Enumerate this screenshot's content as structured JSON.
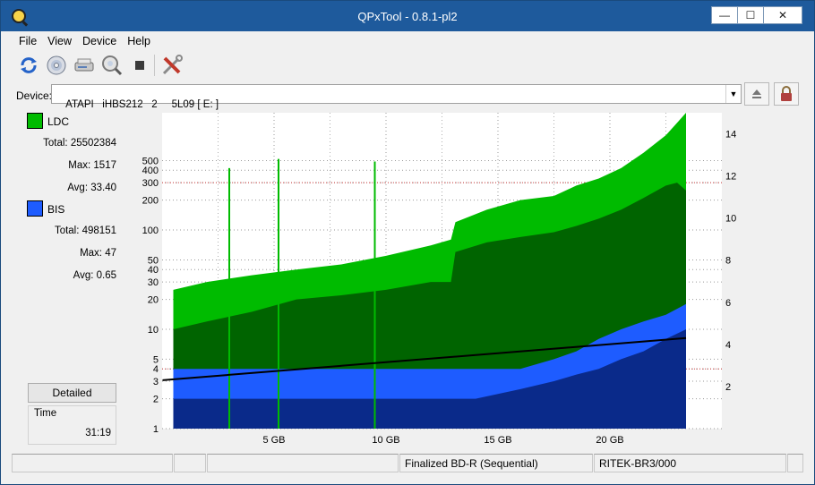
{
  "window": {
    "title": "QPxTool - 0.8.1-pl2",
    "minimize": "—",
    "maximize": "☐",
    "close": "✕"
  },
  "menu": [
    "File",
    "View",
    "Device",
    "Help"
  ],
  "toolbar": {
    "buttons": [
      "refresh-icon",
      "disc-info-icon",
      "scanner-icon",
      "disc-scan-icon",
      "stop-icon",
      "settings-tools-icon"
    ]
  },
  "device": {
    "label": "Device:",
    "value": "ATAPI   iHBS212   2     5L09 [ E: ]"
  },
  "ldc": {
    "name": "LDC",
    "color": "#00bb00",
    "total": "Total: 25502384",
    "max": "Max: 1517",
    "avg": "Avg: 33.40"
  },
  "bis": {
    "name": "BIS",
    "color": "#1e5cff",
    "total": "Total: 498151",
    "max": "Max: 47",
    "avg": "Avg: 0.65"
  },
  "detailed_label": "Detailed",
  "time": {
    "label": "Time",
    "value": "31:19"
  },
  "status": {
    "disc_type": "Finalized BD-R (Sequential)",
    "media_id": "RITEK-BR3/000"
  },
  "chart_data": {
    "type": "area",
    "y_left_scale": "log",
    "ylim_left": [
      1,
      1517
    ],
    "y_left_ticks": [
      "1",
      "2",
      "3",
      "4",
      "5",
      "10",
      "20",
      "30",
      "40",
      "50",
      "100",
      "200",
      "300",
      "400",
      "500"
    ],
    "y_right_ticks": [
      "2",
      "4",
      "6",
      "8",
      "10",
      "12",
      "14"
    ],
    "ylim_right": [
      0,
      15
    ],
    "x_ticks": [
      "5 GB",
      "10 GB",
      "15 GB",
      "20 GB"
    ],
    "xlim": [
      0,
      25
    ],
    "grid": true,
    "series": [
      {
        "name": "LDC",
        "color": "#00bb00",
        "x": [
          0.5,
          2,
          4,
          6,
          8,
          10,
          12,
          12.9,
          13.1,
          14.5,
          16,
          17.5,
          18.5,
          19.5,
          20.5,
          21.5,
          22.5,
          23,
          23.4
        ],
        "max": [
          25,
          30,
          35,
          40,
          45,
          55,
          70,
          80,
          120,
          160,
          200,
          220,
          280,
          330,
          420,
          600,
          900,
          1200,
          1517
        ],
        "avg": [
          10,
          12,
          15,
          20,
          22,
          25,
          30,
          30,
          60,
          75,
          85,
          95,
          110,
          130,
          160,
          210,
          280,
          300,
          250
        ]
      },
      {
        "name": "BIS",
        "color": "#1e5cff",
        "x": [
          0.5,
          4,
          8,
          12,
          14,
          16,
          17.5,
          18.5,
          19.5,
          20.5,
          21.5,
          22.5,
          23.4
        ],
        "max": [
          4,
          4,
          4,
          4,
          4,
          4,
          5,
          6,
          8,
          10,
          12,
          14,
          18
        ],
        "avg": [
          2,
          2,
          2,
          2,
          2,
          2.5,
          3,
          3.5,
          4,
          5,
          6,
          8,
          10
        ]
      },
      {
        "name": "Jitter",
        "color": "#000000",
        "x": [
          0,
          23.4
        ],
        "y": [
          2.3,
          4.3
        ]
      }
    ],
    "peaks_ldc": [
      {
        "x": 3.0,
        "y": 420
      },
      {
        "x": 5.2,
        "y": 520
      },
      {
        "x": 9.5,
        "y": 490
      }
    ]
  }
}
